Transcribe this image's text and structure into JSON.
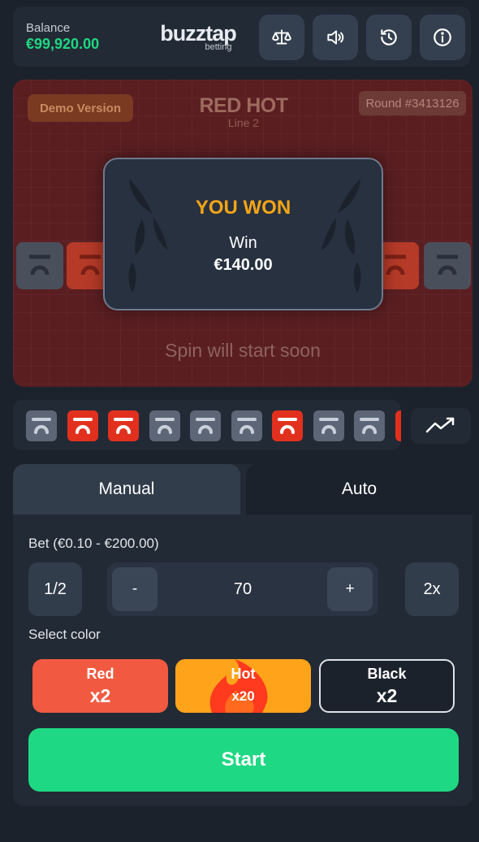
{
  "header": {
    "balance_label": "Balance",
    "balance_value": "€99,920.00",
    "brand_name": "buzztap",
    "brand_sub": "betting",
    "buttons": [
      "scales-icon",
      "sound-icon",
      "history-icon",
      "info-icon"
    ]
  },
  "game": {
    "demo_label": "Demo Version",
    "logo_main": "RED HOT",
    "logo_sub": "Line 2",
    "round_label": "Round #3413126",
    "spin_status": "Spin will start soon"
  },
  "win_modal": {
    "title": "YOU WON",
    "label": "Win",
    "amount": "€140.00"
  },
  "history": {
    "results": [
      "dark",
      "red",
      "red",
      "dark",
      "dark",
      "dark",
      "red",
      "dark",
      "dark",
      "red"
    ]
  },
  "tabs": {
    "manual": "Manual",
    "auto": "Auto",
    "active": "Manual"
  },
  "bet": {
    "label": "Bet (€0.10 - €200.00)",
    "half": "1/2",
    "minus": "-",
    "value": "70",
    "plus": "+",
    "double": "2x"
  },
  "colors": {
    "label": "Select color",
    "options": [
      {
        "name": "Red",
        "multiplier": "x2",
        "color": "#f15a41"
      },
      {
        "name": "Hot",
        "multiplier": "x20",
        "color": "#ffa41a"
      },
      {
        "name": "Black",
        "multiplier": "x2",
        "color": "#1b222c"
      }
    ]
  },
  "start_label": "Start",
  "palette": {
    "accent_green": "#1fd883",
    "win_orange": "#f7a516",
    "tile_red": "#e2301f",
    "tile_dark": "#5d6676"
  }
}
